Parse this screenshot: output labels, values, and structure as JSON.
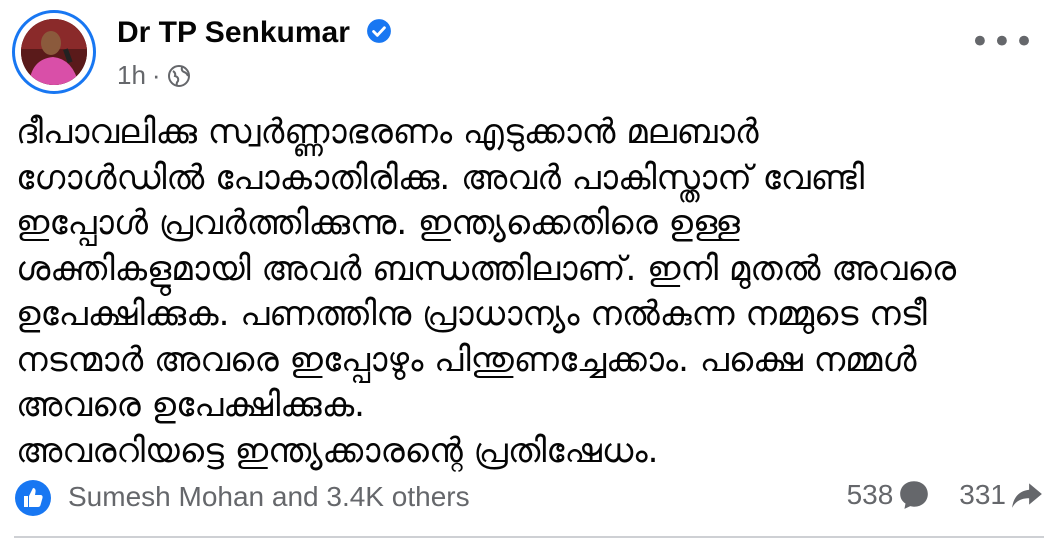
{
  "author": {
    "name": "Dr TP Senkumar",
    "verified": true
  },
  "meta": {
    "time": "1h",
    "separator": "·",
    "audience_icon": "globe-icon"
  },
  "post": {
    "lines": [
      "ദീപാവലിക്കു സ്വർണ്ണാഭരണം  എടുക്കാൻ മലബാർ",
      "ഗോൾഡിൽ പോകാതിരിക്കു. അവർ പാകിസ്താന് വേണ്ടി",
      "ഇപ്പോൾ പ്രവർത്തിക്കുന്നു. ഇന്ത്യക്കെതിരെ ഉള്ള",
      "ശക്തികളുമായി അവർ ബന്ധത്തിലാണ്. ഇനി മുതൽ അവരെ",
      "ഉപേക്ഷിക്കുക. പണത്തിനു പ്രാധാന്യം നൽകുന്ന നമ്മുടെ നടീ",
      "നടന്മാർ അവരെ ഇപ്പോഴും പിന്തുണച്ചേക്കാം. പക്ഷെ നമ്മൾ",
      "അവരെ ഉപേക്ഷിക്കുക.",
      "അവരറിയട്ടെ ഇന്ത്യക്കാരന്റെ പ്രതിഷേധം."
    ]
  },
  "reactions": {
    "summary": "Sumesh Mohan and 3.4K others",
    "icon": "like-icon"
  },
  "counts": {
    "comments": "538",
    "shares": "331"
  },
  "colors": {
    "accent": "#1877f2",
    "secondary_text": "#65676b",
    "divider": "#ced0d4"
  }
}
